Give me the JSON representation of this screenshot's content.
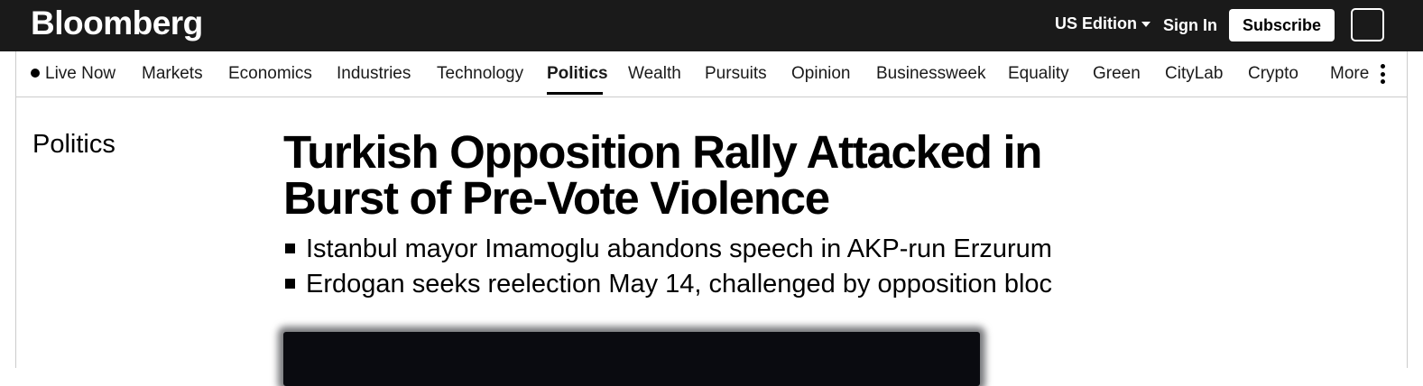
{
  "topbar": {
    "logo": "Bloomberg",
    "edition": "US Edition",
    "sign_in": "Sign In",
    "subscribe": "Subscribe"
  },
  "nav": {
    "items": [
      {
        "label": "Live Now",
        "live": true
      },
      {
        "label": "Markets"
      },
      {
        "label": "Economics"
      },
      {
        "label": "Industries"
      },
      {
        "label": "Technology"
      },
      {
        "label": "Politics",
        "active": true
      },
      {
        "label": "Wealth"
      },
      {
        "label": "Pursuits"
      },
      {
        "label": "Opinion"
      },
      {
        "label": "Businessweek"
      },
      {
        "label": "Equality"
      },
      {
        "label": "Green"
      },
      {
        "label": "CityLab"
      },
      {
        "label": "Crypto"
      },
      {
        "label": "More"
      }
    ]
  },
  "article": {
    "section": "Politics",
    "headline": "Turkish Opposition Rally Attacked in Burst of Pre-Vote Violence",
    "bullets": [
      "Istanbul mayor Imamoglu abandons speech in AKP-run Erzurum",
      "Erdogan seeks reelection May 14, challenged by opposition bloc"
    ]
  }
}
